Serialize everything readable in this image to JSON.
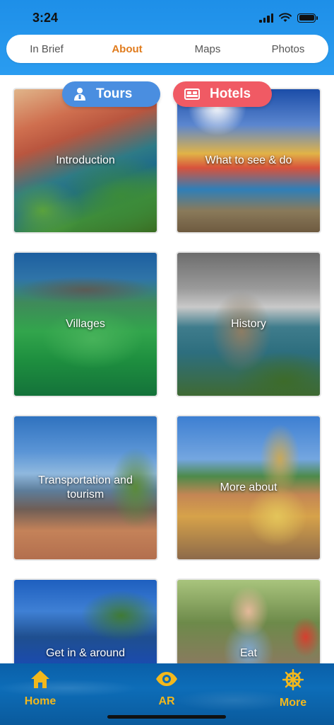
{
  "status_bar": {
    "time": "3:24"
  },
  "segmented_control": {
    "tabs": [
      {
        "label": "In Brief",
        "active": false
      },
      {
        "label": "About",
        "active": true
      },
      {
        "label": "Maps",
        "active": false
      },
      {
        "label": "Photos",
        "active": false
      }
    ]
  },
  "floating_buttons": {
    "tours": {
      "label": "Tours",
      "icon": "person-icon"
    },
    "hotels": {
      "label": "Hotels",
      "icon": "bed-icon"
    }
  },
  "cards": [
    {
      "label": "Introduction"
    },
    {
      "label": "What to see & do"
    },
    {
      "label": "Villages"
    },
    {
      "label": "History"
    },
    {
      "label": "Transportation and tourism"
    },
    {
      "label": "More about"
    },
    {
      "label": "Get in & around"
    },
    {
      "label": "Eat"
    }
  ],
  "tab_bar": {
    "items": [
      {
        "label": "Home",
        "icon": "home-icon"
      },
      {
        "label": "AR",
        "icon": "eye-icon"
      },
      {
        "label": "More",
        "icon": "ship-wheel-icon"
      }
    ]
  },
  "colors": {
    "header": "#1e8fe8",
    "active_tab": "#e07b1c",
    "tours_pill": "#4a8ee0",
    "hotels_pill": "#f05a64",
    "tab_bar_accent": "#f2b81d",
    "tab_bar_bg": "#0a5fa8"
  }
}
